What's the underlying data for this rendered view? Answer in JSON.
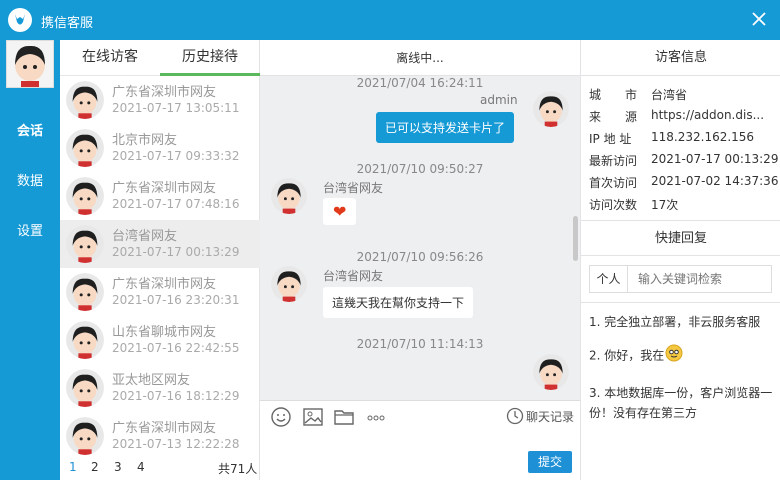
{
  "app": {
    "title": "携信客服"
  },
  "nav": {
    "items": [
      "会话",
      "数据",
      "设置"
    ]
  },
  "visitors": {
    "tabs": [
      "在线访客",
      "历史接待"
    ],
    "list": [
      {
        "name": "广东省深圳市网友",
        "time": "2021-07-17 13:05:11"
      },
      {
        "name": "北京市网友",
        "time": "2021-07-17 09:33:32"
      },
      {
        "name": "广东省深圳市网友",
        "time": "2021-07-17 07:48:16"
      },
      {
        "name": "台湾省网友",
        "time": "2021-07-17 00:13:29"
      },
      {
        "name": "广东省深圳市网友",
        "time": "2021-07-16 23:20:31"
      },
      {
        "name": "山东省聊城市网友",
        "time": "2021-07-16 22:42:55"
      },
      {
        "name": "亚太地区网友",
        "time": "2021-07-16 18:12:29"
      },
      {
        "name": "广东省深圳市网友",
        "time": "2021-07-13 12:22:28"
      }
    ],
    "pager": {
      "pages": [
        "1",
        "2",
        "3",
        "4"
      ],
      "total": "共71人"
    }
  },
  "chat": {
    "status": "离线中...",
    "messages": [
      {
        "time": "2021/07/04 16:24:11",
        "sender": "admin",
        "text": "已可以支持发送卡片了"
      },
      {
        "time": "2021/07/10 09:50:27",
        "sender": "台湾省网友",
        "text": "❤"
      },
      {
        "time": "2021/07/10 09:56:26",
        "sender": "台湾省网友",
        "text": "這幾天我在幫你支持一下"
      },
      {
        "time": "2021/07/10 11:14:13",
        "sender": "admin",
        "text": ""
      }
    ],
    "history_label": "聊天记录",
    "submit_label": "提交"
  },
  "info": {
    "title": "访客信息",
    "fields": [
      {
        "k": "城　　市",
        "v": "台湾省"
      },
      {
        "k": "来　　源",
        "v": "https://addon.dis..."
      },
      {
        "k": "IP 地 址",
        "v": "118.232.162.156"
      },
      {
        "k": "最新访问",
        "v": "2021-07-17 00:13:29"
      },
      {
        "k": "首次访问",
        "v": "2021-07-02 14:37:36"
      },
      {
        "k": "访问次数",
        "v": "17次"
      }
    ],
    "quick_title": "快捷回复",
    "search_label": "个人",
    "search_placeholder": "输入关键词检索",
    "replies": [
      "1. 完全独立部署，非云服务客服",
      "2. 你好，我在",
      "3. 本地数据库一份，客户浏览器一份！没有存在第三方"
    ]
  },
  "colors": {
    "primary": "#159ad6",
    "tab_active": "#5cb85c"
  }
}
